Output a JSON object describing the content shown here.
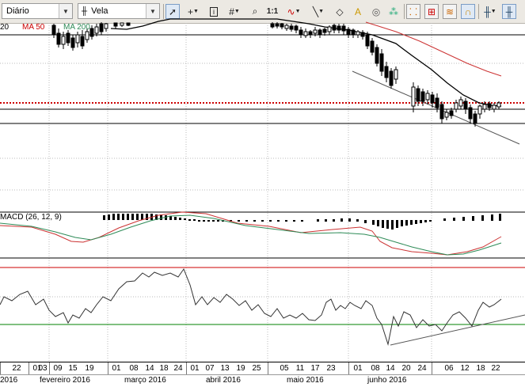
{
  "toolbar": {
    "period": "Diário",
    "chart_type": "Vela",
    "zoom_label": "1:1"
  },
  "legend": {
    "ma20_fragment": "20",
    "ma50": "MA 50",
    "ma200": "MA 200",
    "macd": "MACD (26, 12, 9)"
  },
  "icons": [
    "cursor-icon",
    "crosshair-icon",
    "info-icon",
    "grid-icon",
    "zoom-icon",
    "indicator-icon",
    "line-tool-icon",
    "eraser-icon",
    "text-tool-icon",
    "color-icon",
    "alert-icon",
    "scatter-icon",
    "bars-icon",
    "wave-icon",
    "candles-icon"
  ],
  "colors": {
    "ma20": "#000000",
    "ma50": "#cc0000",
    "ma200": "#2e8b57",
    "resistance_dotted": "#cc0000",
    "upper_band": "#cc0000",
    "lower_band": "#008000"
  },
  "axis": {
    "days": [
      "22",
      "01",
      "03",
      "09",
      "15",
      "19",
      "01",
      "08",
      "14",
      "18",
      "24",
      "01",
      "07",
      "13",
      "19",
      "25",
      "05",
      "11",
      "17",
      "23",
      "01",
      "08",
      "14",
      "20",
      "24",
      "06",
      "12",
      "18",
      "22"
    ],
    "months": [
      "2016",
      "fevereiro 2016",
      "março 2016",
      "abril 2016",
      "maio 2016",
      "junho 2016"
    ]
  }
}
